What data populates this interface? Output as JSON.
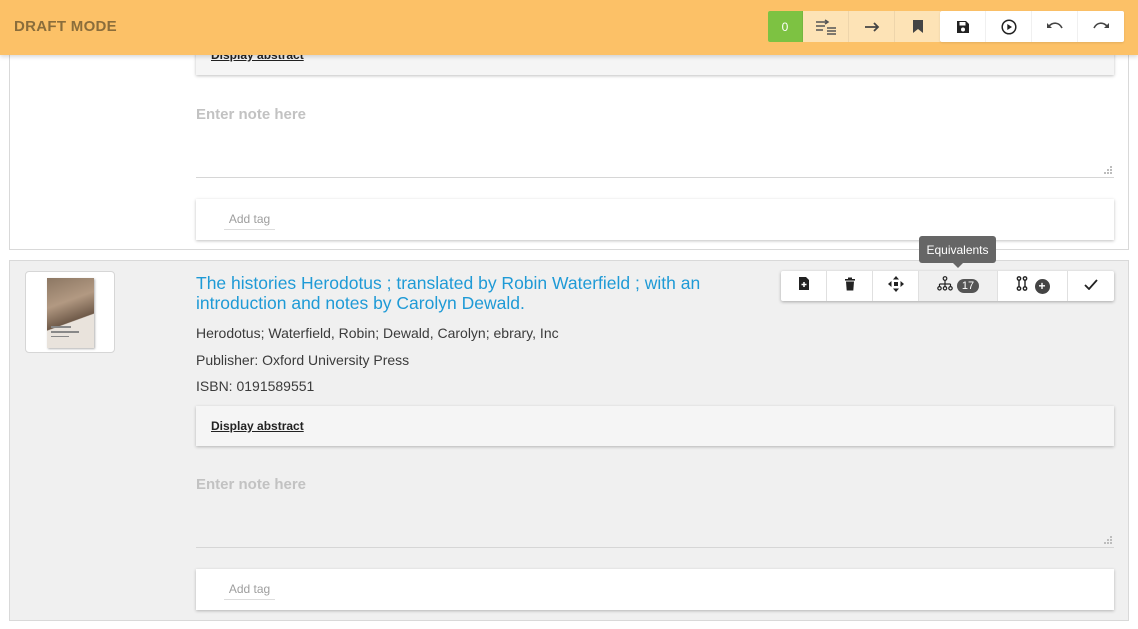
{
  "toolbar": {
    "mode_label": "DRAFT MODE",
    "count": "0",
    "icons": [
      "sort-list-icon",
      "arrow-right-icon",
      "bookmark-icon",
      "save-icon",
      "play-icon",
      "undo-icon",
      "redo-icon"
    ]
  },
  "records": [
    {
      "abstract_label": "Display abstract",
      "note_placeholder": "Enter note here",
      "tag_placeholder": "Add tag"
    },
    {
      "title": "The histories Herodotus ; translated by Robin Waterfield ; with an introduction and notes by Carolyn Dewald.",
      "authors": "Herodotus; Waterfield, Robin; Dewald, Carolyn; ebrary, Inc",
      "publisher": "Publisher: Oxford University Press",
      "isbn": "ISBN: 0191589551",
      "abstract_label": "Display abstract",
      "note_placeholder": "Enter note here",
      "tag_placeholder": "Add tag",
      "equivalents_count": "17",
      "tooltip": "Equivalents",
      "action_icons": [
        "add-document-icon",
        "trash-icon",
        "move-icon",
        "hierarchy-icon",
        "link-icon",
        "check-icon"
      ]
    }
  ],
  "colors": {
    "topbar": "#fcc167",
    "count_badge": "#7dc242",
    "title_link": "#1e9ad6"
  }
}
